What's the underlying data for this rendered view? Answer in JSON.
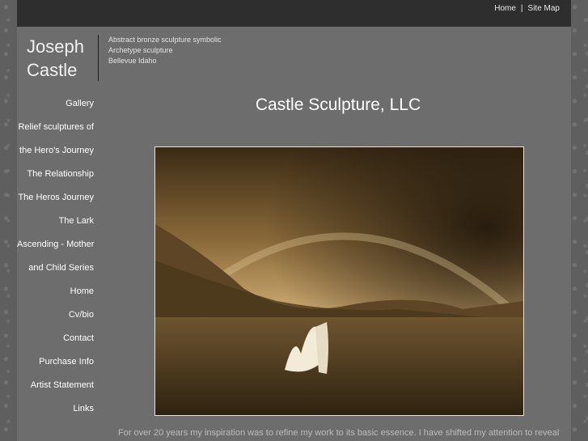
{
  "topnav": {
    "home": "Home",
    "separator": "|",
    "sitemap": "Site Map"
  },
  "logo": {
    "line1": "Joseph",
    "line2": "Castle"
  },
  "tagline": [
    "Abstract bronze sculpture symbolic",
    "Archetype sculpture",
    "Bellevue Idaho"
  ],
  "sidebar": {
    "items": [
      "Gallery",
      "Relief sculptures of",
      "the Hero's Journey",
      "The Relationship",
      "The Heros Journey",
      "The Lark",
      "Ascending - Mother",
      "and Child Series",
      "Home",
      "Cv/bio",
      "Contact",
      "Purchase Info",
      "Artist Statement",
      "Links"
    ]
  },
  "main": {
    "title": "Castle Sculpture, LLC",
    "body": "For over 20 years my inspiration was to refine my work to its basic essence. I have shifted my attention to reveal"
  },
  "colors": {
    "background": "#5f5f5f",
    "topbar": "#2e2e2e",
    "sepia": "#8a6a3a"
  }
}
